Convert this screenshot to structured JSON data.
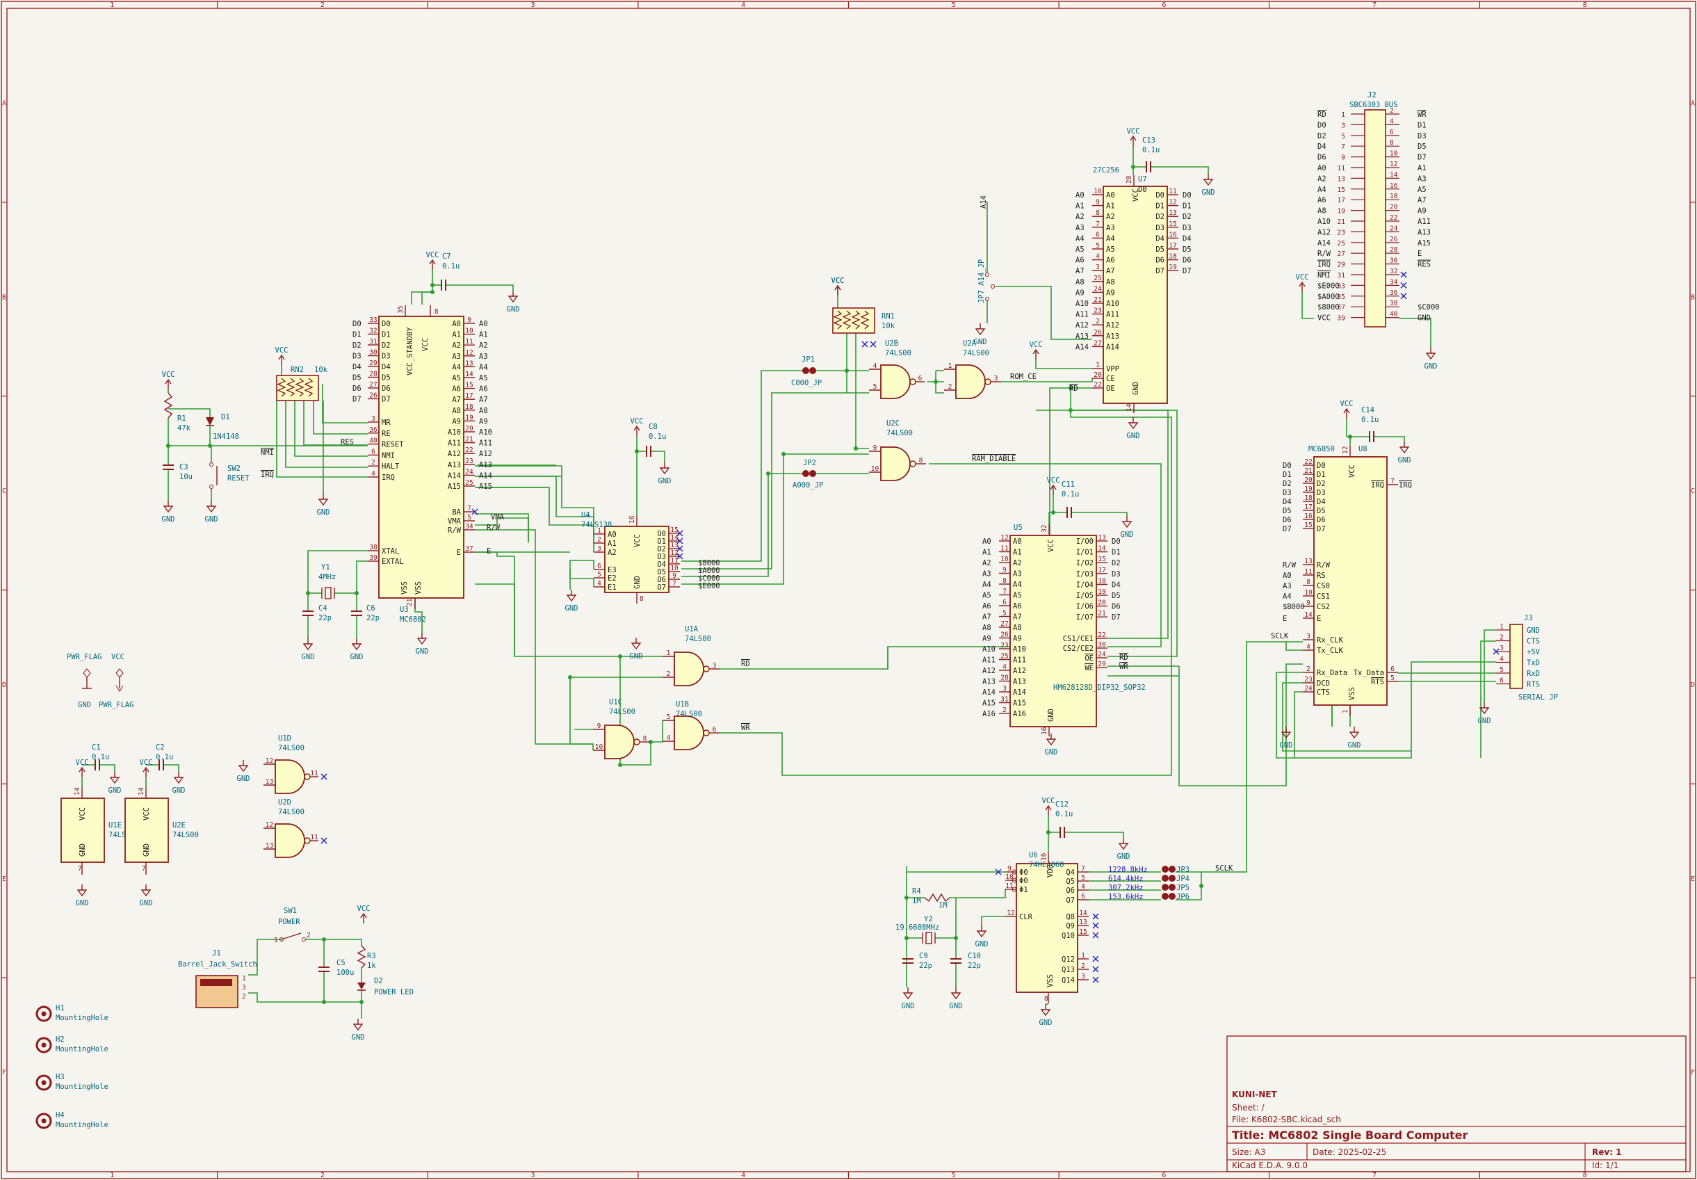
{
  "colors": {
    "frame": "#a02020",
    "wire": "#2e9c2e",
    "body": "#fdfdc8",
    "pin": "#8c1a1a",
    "ref": "#00667c",
    "label": "#1a1a1a",
    "nc": "#2020c0"
  },
  "frame": {
    "cols": [
      "1",
      "2",
      "3",
      "4",
      "5",
      "6",
      "7",
      "8"
    ],
    "rows": [
      "A",
      "B",
      "C",
      "D",
      "E",
      "F"
    ]
  },
  "title_block": {
    "company": "KUNI-NET",
    "sheet": "Sheet: /",
    "file": "File: K6802-SBC.kicad_sch",
    "title": "Title: MC6802 Single Board Computer",
    "size": "Size: A3",
    "date": "Date: 2025-02-25",
    "rev": "Rev: 1",
    "tool": "KiCad E.D.A. 9.0.0",
    "id": "Id: 1/1"
  },
  "chips": {
    "u3": {
      "ref": "U3",
      "value": "MC6802",
      "left": [
        [
          "D0",
          "33"
        ],
        [
          "D1",
          "32"
        ],
        [
          "D2",
          "31"
        ],
        [
          "D3",
          "30"
        ],
        [
          "D4",
          "29"
        ],
        [
          "D5",
          "28"
        ],
        [
          "D6",
          "27"
        ],
        [
          "D7",
          "26"
        ]
      ],
      "right": [
        [
          "A0",
          "9"
        ],
        [
          "A1",
          "10"
        ],
        [
          "A2",
          "11"
        ],
        [
          "A3",
          "12"
        ],
        [
          "A4",
          "13"
        ],
        [
          "A5",
          "14"
        ],
        [
          "A6",
          "15"
        ],
        [
          "A7",
          "17"
        ],
        [
          "A8",
          "18"
        ],
        [
          "A9",
          "19"
        ],
        [
          "A10",
          "20"
        ],
        [
          "A11",
          "21"
        ],
        [
          "A12",
          "22"
        ],
        [
          "A13",
          "23"
        ],
        [
          "A14",
          "24"
        ],
        [
          "A15",
          "25"
        ]
      ],
      "ctrl": [
        [
          "MR",
          "3"
        ],
        [
          "RE",
          "36"
        ],
        [
          "RESET",
          "40"
        ],
        [
          "NMI",
          "6"
        ],
        [
          "HALT",
          "2"
        ],
        [
          "IRQ",
          "4"
        ]
      ],
      "pins_misc": [
        "VCC_STANDBY",
        "VCC",
        "XTAL",
        "EXTAL",
        "VSS",
        "VSS",
        "BA",
        "VMA",
        "R/W",
        "E"
      ]
    },
    "u7": {
      "ref": "U7",
      "value": "27C256",
      "left": [
        [
          "A0",
          "10"
        ],
        [
          "A1",
          "9"
        ],
        [
          "A2",
          "8"
        ],
        [
          "A3",
          "7"
        ],
        [
          "A4",
          "6"
        ],
        [
          "A5",
          "5"
        ],
        [
          "A6",
          "4"
        ],
        [
          "A7",
          "3"
        ],
        [
          "A8",
          "25"
        ],
        [
          "A9",
          "24"
        ],
        [
          "A10",
          "21"
        ],
        [
          "A11",
          "23"
        ],
        [
          "A12",
          "2"
        ],
        [
          "A13",
          "26"
        ],
        [
          "A14",
          "27"
        ]
      ],
      "right": [
        [
          "D0",
          "11"
        ],
        [
          "D1",
          "12"
        ],
        [
          "D2",
          "13"
        ],
        [
          "D3",
          "15"
        ],
        [
          "D4",
          "16"
        ],
        [
          "D5",
          "17"
        ],
        [
          "D6",
          "18"
        ],
        [
          "D7",
          "19"
        ]
      ],
      "ctrl": [
        "VPP",
        "CE",
        "OE"
      ]
    },
    "u5": {
      "ref": "U5",
      "value": "HM628128D_DIP32_SOP32",
      "left": [
        [
          "A0",
          "12"
        ],
        [
          "A1",
          "11"
        ],
        [
          "A2",
          "10"
        ],
        [
          "A3",
          "9"
        ],
        [
          "A4",
          "8"
        ],
        [
          "A5",
          "7"
        ],
        [
          "A6",
          "6"
        ],
        [
          "A7",
          "5"
        ],
        [
          "A8",
          "27"
        ],
        [
          "A9",
          "26"
        ],
        [
          "A10",
          "23"
        ],
        [
          "A11",
          "25"
        ],
        [
          "A12",
          "4"
        ],
        [
          "A13",
          "28"
        ],
        [
          "A14",
          "3"
        ],
        [
          "A15",
          "31"
        ],
        [
          "A16",
          "2"
        ]
      ],
      "right": [
        [
          "I/O0",
          "13"
        ],
        [
          "I/O1",
          "14"
        ],
        [
          "I/O2",
          "15"
        ],
        [
          "I/O3",
          "17"
        ],
        [
          "I/O4",
          "18"
        ],
        [
          "I/O5",
          "19"
        ],
        [
          "I/O6",
          "20"
        ],
        [
          "I/O7",
          "21"
        ]
      ],
      "ctrl": [
        [
          "CS1/CE1",
          "22"
        ],
        [
          "CS2/CE2",
          "30"
        ],
        [
          "OE",
          "24"
        ],
        [
          "WE",
          "29"
        ]
      ]
    },
    "u4": {
      "ref": "U4",
      "value": "74LS138",
      "left": [
        "A0",
        "A1",
        "A2",
        "E3",
        "E2",
        "E1"
      ],
      "right": [
        "O0",
        "O1",
        "O2",
        "O3",
        "O4",
        "O5",
        "O6",
        "O7"
      ]
    },
    "u8": {
      "ref": "U8",
      "value": "MC6850",
      "left": [
        "D0",
        "D1",
        "D2",
        "D3",
        "D4",
        "D5",
        "D6",
        "D7",
        "R/W",
        "RS",
        "CS0",
        "CS1",
        "CS2",
        "E",
        "Rx_CLK",
        "Tx_CLK",
        "Rx_Data",
        "DCD",
        "CTS"
      ],
      "right": [
        "IRQ",
        "Tx_Data",
        "RTS"
      ]
    },
    "u6": {
      "ref": "U6",
      "value": "74HC4060",
      "left": [
        "Φ0",
        "Φ0",
        "Φ1",
        "CLR"
      ],
      "right": [
        "Q4",
        "Q5",
        "Q6",
        "Q7",
        "Q8",
        "Q9",
        "Q10",
        "Q12",
        "Q13",
        "Q14"
      ]
    }
  },
  "nets": {
    "d": [
      "D0",
      "D1",
      "D2",
      "D3",
      "D4",
      "D5",
      "D6",
      "D7"
    ],
    "a16": [
      "A0",
      "A1",
      "A2",
      "A3",
      "A4",
      "A5",
      "A6",
      "A7",
      "A8",
      "A9",
      "A10",
      "A11",
      "A12",
      "A13",
      "A14",
      "A15"
    ],
    "decode": [
      "$8000",
      "$A000",
      "$C000",
      "$E000"
    ],
    "misc": [
      "VMA",
      "R/W",
      "E",
      "RES",
      "NMI",
      "IRQ",
      "ROM_CE",
      "RAM_DIABLE",
      "RD",
      "WR",
      "SCLK",
      "A14"
    ]
  },
  "gates": [
    {
      "ref": "U1A",
      "value": "74LS00"
    },
    {
      "ref": "U1B",
      "value": "74LS00"
    },
    {
      "ref": "U1C",
      "value": "74LS00"
    },
    {
      "ref": "U2A",
      "value": "74LS00"
    },
    {
      "ref": "U2B",
      "value": "74LS00"
    },
    {
      "ref": "U2C",
      "value": "74LS00"
    },
    {
      "ref": "U1D",
      "value": "74LS00"
    },
    {
      "ref": "U2D",
      "value": "74LS00"
    },
    {
      "ref": "U1E",
      "value": "74LS00"
    },
    {
      "ref": "U2E",
      "value": "74LS00"
    }
  ],
  "parts": {
    "c7": [
      "C7",
      "0.1u"
    ],
    "c8": [
      "C8",
      "0.1u"
    ],
    "c11": [
      "C11",
      "0.1u"
    ],
    "c12": [
      "C12",
      "0.1u"
    ],
    "c13": [
      "C13",
      "0.1u"
    ],
    "c14": [
      "C14",
      "0.1u"
    ],
    "c1": [
      "C1",
      "0.1u"
    ],
    "c2": [
      "C2",
      "0.1u"
    ],
    "c3": [
      "C3",
      "10u"
    ],
    "c4": [
      "C4",
      "22p"
    ],
    "c6": [
      "C6",
      "22p"
    ],
    "c9": [
      "C9",
      "22p"
    ],
    "c10": [
      "C10",
      "22p"
    ],
    "c5": [
      "C5",
      "100u"
    ],
    "r1": [
      "R1",
      "47k"
    ],
    "r3": [
      "R3",
      "1k"
    ],
    "r4": [
      "R4",
      "1M"
    ],
    "rn1": [
      "RN1",
      "10k"
    ],
    "rn2": [
      "RN2",
      "10k"
    ],
    "d1": [
      "D1",
      "1N4148"
    ],
    "d2": [
      "D2",
      "POWER LED"
    ],
    "y1": [
      "Y1",
      "4MHz"
    ],
    "y2": [
      "Y2",
      "19.6608MHz"
    ],
    "sw1": [
      "SW1",
      "POWER"
    ],
    "sw2": [
      "SW2",
      "RESET"
    ],
    "j1": [
      "J1",
      "Barrel_Jack_Switch"
    ],
    "j2": [
      "J2",
      "SBC6303 BUS"
    ],
    "j3": [
      "J3",
      "SERIAL JP"
    ],
    "jp1": [
      "JP1",
      "C000_JP"
    ],
    "jp2": [
      "JP2",
      "A000_JP"
    ],
    "jp7": [
      "JP7",
      "A14_JP"
    ],
    "jp3": "JP3",
    "jp4": "JP4",
    "jp5": "JP5",
    "jp6": "JP6"
  },
  "power": {
    "vcc": "VCC",
    "gnd": "GND",
    "pwr_flag": "PWR_FLAG"
  },
  "freqs": [
    "1228.8kHz",
    "614.4kHz",
    "307.2kHz",
    "153.6kHz"
  ],
  "j2_left": [
    [
      "RD",
      "1"
    ],
    [
      "D0",
      "3"
    ],
    [
      "D2",
      "5"
    ],
    [
      "D4",
      "7"
    ],
    [
      "D6",
      "9"
    ],
    [
      "A0",
      "11"
    ],
    [
      "A2",
      "13"
    ],
    [
      "A4",
      "15"
    ],
    [
      "A6",
      "17"
    ],
    [
      "A8",
      "19"
    ],
    [
      "A10",
      "21"
    ],
    [
      "A12",
      "23"
    ],
    [
      "A14",
      "25"
    ],
    [
      "R/W",
      "27"
    ],
    [
      "IRQ",
      "29"
    ],
    [
      "NMI",
      "31"
    ],
    [
      "$E000",
      "33"
    ],
    [
      "$A000",
      "35"
    ],
    [
      "$8000",
      "37"
    ],
    [
      "VCC",
      "39"
    ]
  ],
  "j2_right": [
    [
      "2",
      "WR"
    ],
    [
      "4",
      "D1"
    ],
    [
      "6",
      "D3"
    ],
    [
      "8",
      "D5"
    ],
    [
      "10",
      "D7"
    ],
    [
      "12",
      "A1"
    ],
    [
      "14",
      "A3"
    ],
    [
      "16",
      "A5"
    ],
    [
      "18",
      "A7"
    ],
    [
      "20",
      "A9"
    ],
    [
      "22",
      "A11"
    ],
    [
      "24",
      "A13"
    ],
    [
      "26",
      "A15"
    ],
    [
      "28",
      "E"
    ],
    [
      "30",
      "RES"
    ],
    [
      "32",
      ""
    ],
    [
      "34",
      ""
    ],
    [
      "36",
      ""
    ],
    [
      "38",
      "$C000"
    ],
    [
      "40",
      "GND"
    ]
  ],
  "j3_pins": [
    [
      "1",
      "GND"
    ],
    [
      "2",
      "CTS"
    ],
    [
      "3",
      "+5V"
    ],
    [
      "4",
      "TxD"
    ],
    [
      "5",
      "RxD"
    ],
    [
      "6",
      "RTS"
    ]
  ],
  "holes": [
    [
      "H1",
      "MountingHole"
    ],
    [
      "H2",
      "MountingHole"
    ],
    [
      "H3",
      "MountingHole"
    ],
    [
      "H4",
      "MountingHole"
    ]
  ]
}
